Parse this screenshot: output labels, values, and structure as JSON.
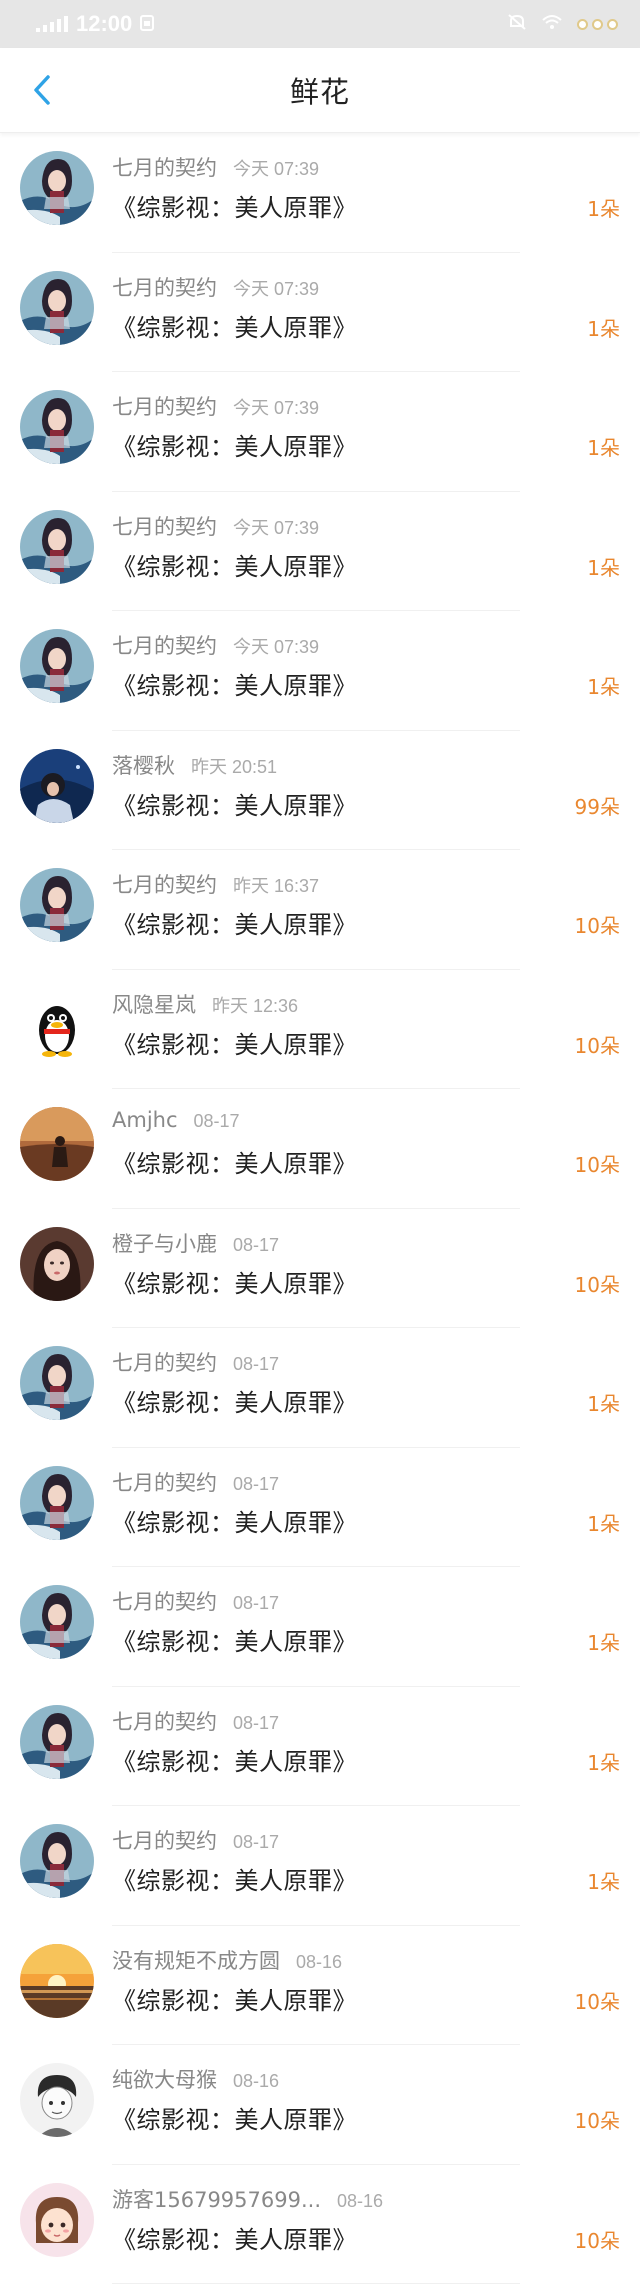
{
  "status_bar": {
    "time": "12:00",
    "sim_icon": "sim-card-icon",
    "mute_icon": "mute-icon",
    "wifi_icon": "wifi-icon"
  },
  "header": {
    "back_icon": "chevron-left-icon",
    "title": "鲜花"
  },
  "colors": {
    "accent": "#2fa3e6",
    "count": "#e9872f"
  },
  "book_title": "《综影视：美人原罪》",
  "rows": [
    {
      "user": "七月的契约",
      "time": "今天 07:39",
      "count": "1朵",
      "avatar": "portrait-girl"
    },
    {
      "user": "七月的契约",
      "time": "今天 07:39",
      "count": "1朵",
      "avatar": "portrait-girl"
    },
    {
      "user": "七月的契约",
      "time": "今天 07:39",
      "count": "1朵",
      "avatar": "portrait-girl"
    },
    {
      "user": "七月的契约",
      "time": "今天 07:39",
      "count": "1朵",
      "avatar": "portrait-girl"
    },
    {
      "user": "七月的契约",
      "time": "今天 07:39",
      "count": "1朵",
      "avatar": "portrait-girl"
    },
    {
      "user": "落樱秋",
      "time": "昨天 20:51",
      "count": "99朵",
      "avatar": "night-girl"
    },
    {
      "user": "七月的契约",
      "time": "昨天 16:37",
      "count": "10朵",
      "avatar": "portrait-girl"
    },
    {
      "user": "风隐星岚",
      "time": "昨天 12:36",
      "count": "10朵",
      "avatar": "penguin"
    },
    {
      "user": "Amjhc",
      "time": "08-17",
      "count": "10朵",
      "avatar": "sunset-figure"
    },
    {
      "user": "橙子与小鹿",
      "time": "08-17",
      "count": "10朵",
      "avatar": "dark-hair-girl"
    },
    {
      "user": "七月的契约",
      "time": "08-17",
      "count": "1朵",
      "avatar": "portrait-girl"
    },
    {
      "user": "七月的契约",
      "time": "08-17",
      "count": "1朵",
      "avatar": "portrait-girl"
    },
    {
      "user": "七月的契约",
      "time": "08-17",
      "count": "1朵",
      "avatar": "portrait-girl"
    },
    {
      "user": "七月的契约",
      "time": "08-17",
      "count": "1朵",
      "avatar": "portrait-girl"
    },
    {
      "user": "七月的契约",
      "time": "08-17",
      "count": "1朵",
      "avatar": "portrait-girl"
    },
    {
      "user": "没有规矩不成方圆",
      "time": "08-16",
      "count": "10朵",
      "avatar": "sunset-sea"
    },
    {
      "user": "纯欲大母猴",
      "time": "08-16",
      "count": "10朵",
      "avatar": "sketch-boy"
    },
    {
      "user": "游客15679957699...",
      "time": "08-16",
      "count": "10朵",
      "avatar": "cartoon-girl"
    }
  ]
}
